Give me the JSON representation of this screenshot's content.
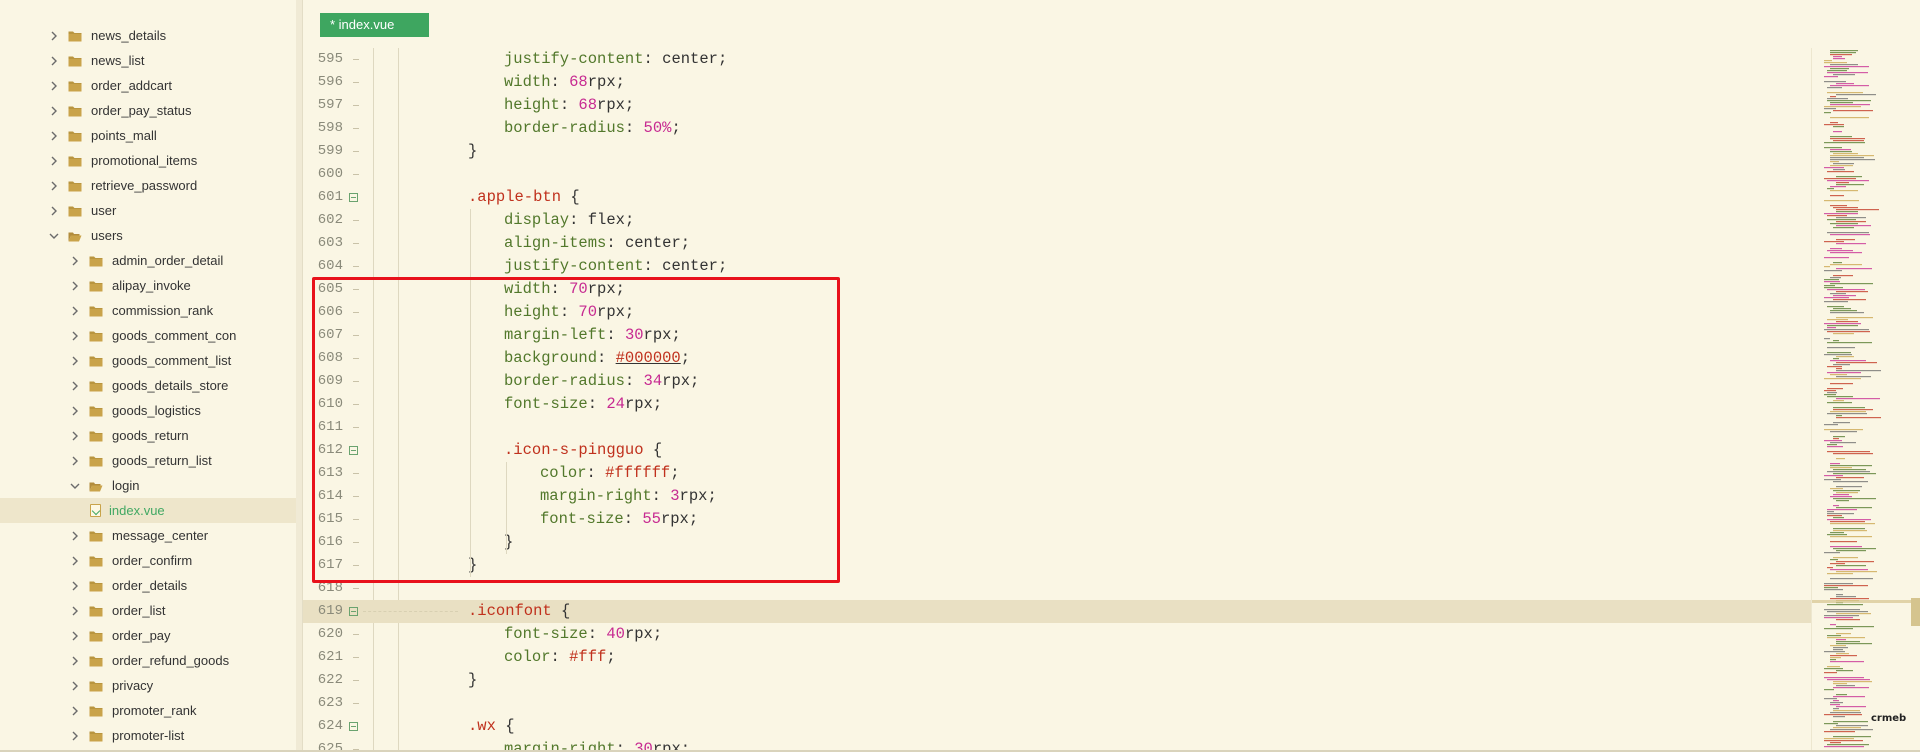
{
  "colors": {
    "background": "#faf6e4",
    "tab_active": "#3ea660",
    "selector": "#c0311d",
    "property": "#52782b",
    "number": "#c72a91",
    "highlight_box": "#e8121b",
    "folder": "#c9a34a"
  },
  "tab": {
    "label": "* index.vue"
  },
  "tree": [
    {
      "label": "news_details",
      "depth": 0,
      "expanded": false,
      "type": "folder"
    },
    {
      "label": "news_list",
      "depth": 0,
      "expanded": false,
      "type": "folder"
    },
    {
      "label": "order_addcart",
      "depth": 0,
      "expanded": false,
      "type": "folder"
    },
    {
      "label": "order_pay_status",
      "depth": 0,
      "expanded": false,
      "type": "folder"
    },
    {
      "label": "points_mall",
      "depth": 0,
      "expanded": false,
      "type": "folder"
    },
    {
      "label": "promotional_items",
      "depth": 0,
      "expanded": false,
      "type": "folder"
    },
    {
      "label": "retrieve_password",
      "depth": 0,
      "expanded": false,
      "type": "folder"
    },
    {
      "label": "user",
      "depth": 0,
      "expanded": false,
      "type": "folder"
    },
    {
      "label": "users",
      "depth": 0,
      "expanded": true,
      "type": "folder"
    },
    {
      "label": "admin_order_detail",
      "depth": 1,
      "expanded": false,
      "type": "folder"
    },
    {
      "label": "alipay_invoke",
      "depth": 1,
      "expanded": false,
      "type": "folder"
    },
    {
      "label": "commission_rank",
      "depth": 1,
      "expanded": false,
      "type": "folder"
    },
    {
      "label": "goods_comment_con",
      "depth": 1,
      "expanded": false,
      "type": "folder"
    },
    {
      "label": "goods_comment_list",
      "depth": 1,
      "expanded": false,
      "type": "folder"
    },
    {
      "label": "goods_details_store",
      "depth": 1,
      "expanded": false,
      "type": "folder"
    },
    {
      "label": "goods_logistics",
      "depth": 1,
      "expanded": false,
      "type": "folder"
    },
    {
      "label": "goods_return",
      "depth": 1,
      "expanded": false,
      "type": "folder"
    },
    {
      "label": "goods_return_list",
      "depth": 1,
      "expanded": false,
      "type": "folder"
    },
    {
      "label": "login",
      "depth": 1,
      "expanded": true,
      "type": "folder"
    },
    {
      "label": "index.vue",
      "depth": 2,
      "expanded": false,
      "type": "file",
      "selected": true
    },
    {
      "label": "message_center",
      "depth": 1,
      "expanded": false,
      "type": "folder"
    },
    {
      "label": "order_confirm",
      "depth": 1,
      "expanded": false,
      "type": "folder"
    },
    {
      "label": "order_details",
      "depth": 1,
      "expanded": false,
      "type": "folder"
    },
    {
      "label": "order_list",
      "depth": 1,
      "expanded": false,
      "type": "folder"
    },
    {
      "label": "order_pay",
      "depth": 1,
      "expanded": false,
      "type": "folder"
    },
    {
      "label": "order_refund_goods",
      "depth": 1,
      "expanded": false,
      "type": "folder"
    },
    {
      "label": "privacy",
      "depth": 1,
      "expanded": false,
      "type": "folder"
    },
    {
      "label": "promoter_rank",
      "depth": 1,
      "expanded": false,
      "type": "folder"
    },
    {
      "label": "promoter-list",
      "depth": 1,
      "expanded": false,
      "type": "folder"
    }
  ],
  "code_lines": [
    {
      "n": "595",
      "tokens": [
        [
          "prop",
          "justify-content"
        ],
        [
          "pun",
          ": "
        ],
        [
          "pun",
          "center"
        ],
        [
          "pun",
          ";"
        ]
      ],
      "indent": 2
    },
    {
      "n": "596",
      "tokens": [
        [
          "prop",
          "width"
        ],
        [
          "pun",
          ": "
        ],
        [
          "num",
          "68"
        ],
        [
          "pun",
          "rpx;"
        ]
      ],
      "indent": 2
    },
    {
      "n": "597",
      "tokens": [
        [
          "prop",
          "height"
        ],
        [
          "pun",
          ": "
        ],
        [
          "num",
          "68"
        ],
        [
          "pun",
          "rpx;"
        ]
      ],
      "indent": 2
    },
    {
      "n": "598",
      "tokens": [
        [
          "prop",
          "border-radius"
        ],
        [
          "pun",
          ": "
        ],
        [
          "num",
          "50"
        ],
        [
          "num",
          "%"
        ],
        [
          "pun",
          ";"
        ]
      ],
      "indent": 2
    },
    {
      "n": "599",
      "tokens": [
        [
          "pun",
          "}"
        ]
      ],
      "indent": 1
    },
    {
      "n": "600",
      "tokens": [],
      "indent": 0
    },
    {
      "n": "601",
      "tokens": [
        [
          "sel",
          ".apple-btn"
        ],
        [
          "pun",
          " {"
        ]
      ],
      "indent": 1,
      "fold": true
    },
    {
      "n": "602",
      "tokens": [
        [
          "prop",
          "display"
        ],
        [
          "pun",
          ": "
        ],
        [
          "pun",
          "flex"
        ],
        [
          "pun",
          ";"
        ]
      ],
      "indent": 2
    },
    {
      "n": "603",
      "tokens": [
        [
          "prop",
          "align-items"
        ],
        [
          "pun",
          ": "
        ],
        [
          "pun",
          "center"
        ],
        [
          "pun",
          ";"
        ]
      ],
      "indent": 2
    },
    {
      "n": "604",
      "tokens": [
        [
          "prop",
          "justify-content"
        ],
        [
          "pun",
          ": "
        ],
        [
          "pun",
          "center"
        ],
        [
          "pun",
          ";"
        ]
      ],
      "indent": 2
    },
    {
      "n": "605",
      "tokens": [
        [
          "prop",
          "width"
        ],
        [
          "pun",
          ": "
        ],
        [
          "num",
          "70"
        ],
        [
          "pun",
          "rpx;"
        ]
      ],
      "indent": 2
    },
    {
      "n": "606",
      "tokens": [
        [
          "prop",
          "height"
        ],
        [
          "pun",
          ": "
        ],
        [
          "num",
          "70"
        ],
        [
          "pun",
          "rpx;"
        ]
      ],
      "indent": 2
    },
    {
      "n": "607",
      "tokens": [
        [
          "prop",
          "margin-left"
        ],
        [
          "pun",
          ": "
        ],
        [
          "num",
          "30"
        ],
        [
          "pun",
          "rpx;"
        ]
      ],
      "indent": 2
    },
    {
      "n": "608",
      "tokens": [
        [
          "prop",
          "background"
        ],
        [
          "pun",
          ": "
        ],
        [
          "hex-ul",
          "#000000"
        ],
        [
          "pun",
          ";"
        ]
      ],
      "indent": 2
    },
    {
      "n": "609",
      "tokens": [
        [
          "prop",
          "border-radius"
        ],
        [
          "pun",
          ": "
        ],
        [
          "num",
          "34"
        ],
        [
          "pun",
          "rpx;"
        ]
      ],
      "indent": 2
    },
    {
      "n": "610",
      "tokens": [
        [
          "prop",
          "font-size"
        ],
        [
          "pun",
          ": "
        ],
        [
          "num",
          "24"
        ],
        [
          "pun",
          "rpx;"
        ]
      ],
      "indent": 2
    },
    {
      "n": "611",
      "tokens": [],
      "indent": 0
    },
    {
      "n": "612",
      "tokens": [
        [
          "sel",
          ".icon-s-pingguo"
        ],
        [
          "pun",
          " {"
        ]
      ],
      "indent": 2,
      "fold": true
    },
    {
      "n": "613",
      "tokens": [
        [
          "prop",
          "color"
        ],
        [
          "pun",
          ": "
        ],
        [
          "hex",
          "#ffffff"
        ],
        [
          "pun",
          ";"
        ]
      ],
      "indent": 3
    },
    {
      "n": "614",
      "tokens": [
        [
          "prop",
          "margin-right"
        ],
        [
          "pun",
          ": "
        ],
        [
          "num",
          "3"
        ],
        [
          "pun",
          "rpx;"
        ]
      ],
      "indent": 3
    },
    {
      "n": "615",
      "tokens": [
        [
          "prop",
          "font-size"
        ],
        [
          "pun",
          ": "
        ],
        [
          "num",
          "55"
        ],
        [
          "pun",
          "rpx;"
        ]
      ],
      "indent": 3
    },
    {
      "n": "616",
      "tokens": [
        [
          "pun",
          "}"
        ]
      ],
      "indent": 2
    },
    {
      "n": "617",
      "tokens": [
        [
          "pun",
          "}"
        ]
      ],
      "indent": 1
    },
    {
      "n": "618",
      "tokens": [],
      "indent": 0
    },
    {
      "n": "619",
      "tokens": [
        [
          "sel",
          ".iconfont"
        ],
        [
          "pun",
          " {"
        ]
      ],
      "indent": 1,
      "fold": true,
      "highlight": true
    },
    {
      "n": "620",
      "tokens": [
        [
          "prop",
          "font-size"
        ],
        [
          "pun",
          ": "
        ],
        [
          "num",
          "40"
        ],
        [
          "pun",
          "rpx;"
        ]
      ],
      "indent": 2
    },
    {
      "n": "621",
      "tokens": [
        [
          "prop",
          "color"
        ],
        [
          "pun",
          ": "
        ],
        [
          "hex",
          "#fff"
        ],
        [
          "pun",
          ";"
        ]
      ],
      "indent": 2
    },
    {
      "n": "622",
      "tokens": [
        [
          "pun",
          "}"
        ]
      ],
      "indent": 1
    },
    {
      "n": "623",
      "tokens": [],
      "indent": 0
    },
    {
      "n": "624",
      "tokens": [
        [
          "sel",
          ".wx"
        ],
        [
          "pun",
          " {"
        ]
      ],
      "indent": 1,
      "fold": true
    },
    {
      "n": "625",
      "tokens": [
        [
          "prop",
          "margin-right"
        ],
        [
          "pun",
          ": "
        ],
        [
          "num",
          "30"
        ],
        [
          "pun",
          "rpx;"
        ]
      ],
      "indent": 2
    }
  ],
  "minimap": {
    "watermark": "crmeb"
  }
}
